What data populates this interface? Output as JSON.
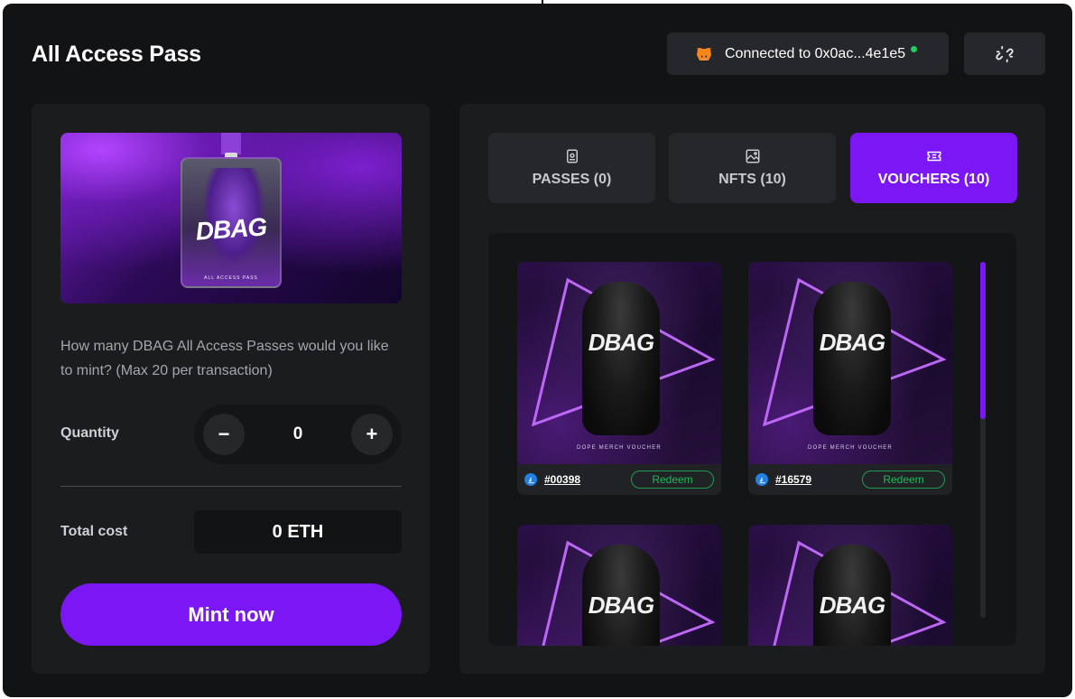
{
  "app": {
    "title": "All Access Pass",
    "connection": "Connected to 0x0ac...4e1e5",
    "connection_status": "connected",
    "accent_color": "#7b16f5",
    "status_color": "#1fce5b"
  },
  "banner": {
    "logo": "DBAG",
    "footer": "ALL ACCESS PASS"
  },
  "mint": {
    "question": "How many DBAG All Access Passes would you like to mint? (Max 20 per transaction)",
    "quantity_label": "Quantity",
    "quantity_value": "0",
    "minus": "−",
    "plus": "+",
    "total_label": "Total cost",
    "total_value": "0 ETH",
    "mint_label": "Mint now"
  },
  "tabs": [
    {
      "label": "PASSES (0)",
      "icon": "badge-icon",
      "active": false
    },
    {
      "label": "NFTS (10)",
      "icon": "image-icon",
      "active": false
    },
    {
      "label": "VOUCHERS (10)",
      "icon": "ticket-icon",
      "active": true
    }
  ],
  "vouchers": [
    {
      "id": "#00398",
      "redeem_label": "Redeem",
      "caption": "DOPE MERCH VOUCHER",
      "logo": "DBAG"
    },
    {
      "id": "#16579",
      "redeem_label": "Redeem",
      "caption": "DOPE MERCH VOUCHER",
      "logo": "DBAG"
    },
    {
      "id": "",
      "redeem_label": "",
      "caption": "",
      "logo": "DBAG"
    },
    {
      "id": "",
      "redeem_label": "",
      "caption": "",
      "logo": "DBAG"
    }
  ]
}
